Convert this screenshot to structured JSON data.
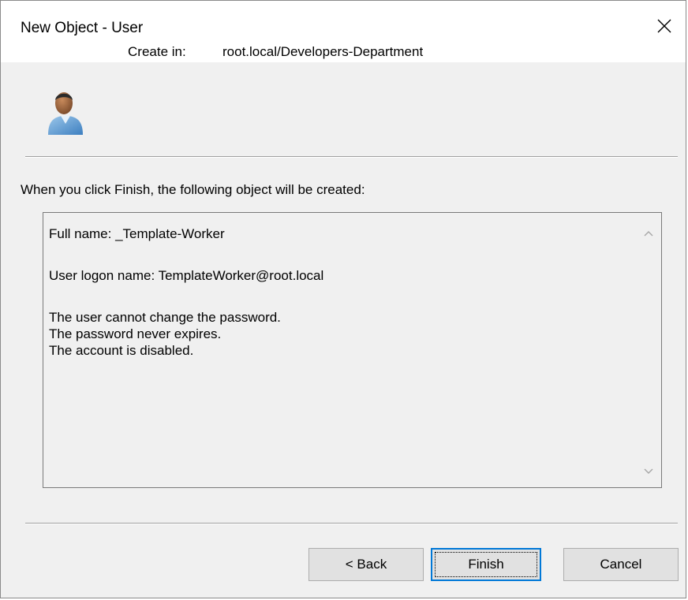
{
  "window": {
    "title": "New Object - User"
  },
  "header": {
    "create_in_label": "Create in:",
    "create_in_value": "root.local/Developers-Department"
  },
  "intro": "When you click Finish, the following object will be created:",
  "summary": {
    "full_name": "Full name: _Template-Worker",
    "logon_name": "User logon name: TemplateWorker@root.local",
    "flags": [
      "The user cannot change the password.",
      "The password never expires.",
      "The account is disabled."
    ]
  },
  "buttons": {
    "back": "< Back",
    "finish": "Finish",
    "cancel": "Cancel"
  },
  "icons": {
    "user": "user-icon",
    "close": "close-icon",
    "scroll_up": "chevron-up-icon",
    "scroll_down": "chevron-down-icon"
  },
  "colors": {
    "window_bg": "#f0f0f0",
    "titlebar_bg": "#ffffff",
    "focus_border": "#0078d7"
  }
}
